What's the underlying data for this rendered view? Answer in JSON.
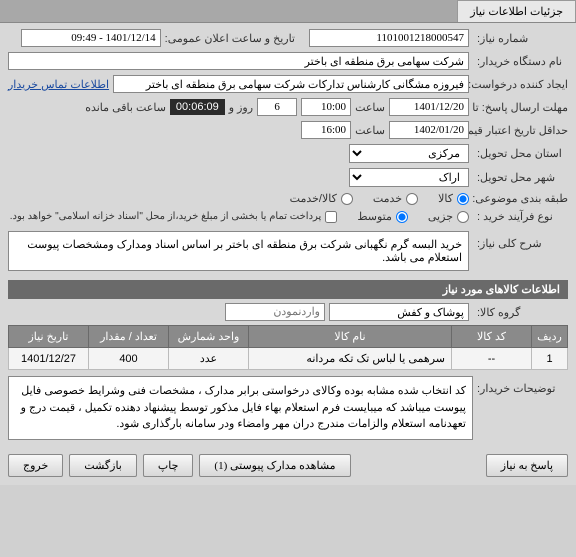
{
  "tab": {
    "title": "جزئیات اطلاعات نیاز"
  },
  "fields": {
    "need_number_label": "شماره نیاز:",
    "need_number": "1101001218000547",
    "announce_label": "تاریخ و ساعت اعلان عمومی:",
    "announce_value": "1401/12/14 - 09:49",
    "buyer_org_label": "نام دستگاه خریدار:",
    "buyer_org": "شرکت سهامی برق منطقه ای باختر",
    "creator_label": "ایجاد کننده درخواست:",
    "creator": "فیروزه مشگانی کارشناس تدارکات شرکت سهامی برق منطقه ای باختر",
    "contact_link": "اطلاعات تماس خریدار",
    "deadline_label": "مهلت ارسال پاسخ: تا تاریخ:",
    "deadline_date": "1401/12/20",
    "time_label": "ساعت",
    "deadline_time": "10:00",
    "days_and": "روز و",
    "days_value": "6",
    "remaining_time": "00:06:09",
    "remaining_label": "ساعت باقی مانده",
    "validity_label": "حداقل تاریخ اعتبار قیمت: تا تاریخ:",
    "validity_date": "1402/01/20",
    "validity_time": "16:00",
    "province_label": "استان محل تحویل:",
    "province": "مرکزی",
    "city_label": "شهر محل تحویل:",
    "city": "اراک",
    "category_label": "طبقه بندی موضوعی:",
    "cat_goods": "کالا",
    "cat_service": "خدمت",
    "cat_both": "کالا/خدمت",
    "purchase_type_label": "نوع فرآیند خرید :",
    "pt_small": "جزیی",
    "pt_medium": "متوسط",
    "pt_note": "پرداخت تمام یا بخشی از مبلغ خرید،از محل \"اسناد خزانه اسلامی\" خواهد بود.",
    "desc_label": "شرح کلی نیاز:",
    "desc_text": "خرید البسه گرم نگهبانی شرکت برق منطقه ای باختر بر اساس اسناد ومدارک ومشخصات پیوست استعلام می باشد."
  },
  "goods_header": "اطلاعات کالاهای مورد نیاز",
  "goods": {
    "group_label": "گروه کالا:",
    "group_value": "پوشاک و کفش",
    "group_placeholder": "واردنمودن"
  },
  "table": {
    "headers": [
      "ردیف",
      "کد کالا",
      "نام کالا",
      "واحد شمارش",
      "تعداد / مقدار",
      "تاریخ نیاز"
    ],
    "rows": [
      {
        "row": "1",
        "code": "--",
        "name": "سرهمی یا لباس تک تکه مردانه",
        "unit": "عدد",
        "qty": "400",
        "date": "1401/12/27"
      }
    ]
  },
  "buyer_notes": {
    "label": "توضیحات خریدار:",
    "text": "کد انتخاب شده مشابه بوده وکالای درخواستی برابر مدارک ، مشخصات فنی وشرایط خصوصی فایل پیوست میباشد که میبایست فرم استعلام بهاء فایل مذکور توسط پیشنهاد دهنده تکمیل ، قیمت درج و تعهدنامه استعلام والزامات  مندرج دران مهر وامضاء ودر سامانه بارگذاری شود."
  },
  "footer": {
    "reply": "پاسخ به نیاز",
    "attachments": "مشاهده مدارک پیوستی (1)",
    "print": "چاپ",
    "back": "بازگشت",
    "exit": "خروج"
  }
}
